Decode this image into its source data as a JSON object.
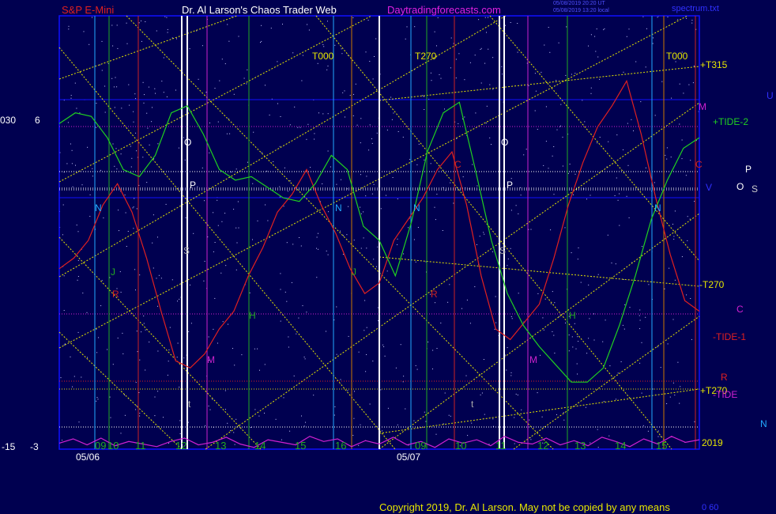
{
  "header": {
    "symbol": "S&P E-Mini",
    "author": "Dr. Al Larson's Chaos Trader Web",
    "site": "Daytradingforecasts.com",
    "stamp_ut": "05/08/2019 20:20 UT",
    "stamp_local": "05/08/2019 13:20 local",
    "file": "spectrum.txt"
  },
  "footer": {
    "copyright": "Copyright 2019, Dr. Al Larson. May not be copied by any means",
    "corner": "0  60"
  },
  "left_scale": {
    "top_a": "030",
    "top_b": "6",
    "bot_a": "-15",
    "bot_b": "-3"
  },
  "colors": {
    "background": "#000050",
    "frame": "#1010ff",
    "price": "#e02020",
    "tide2": "#20d020",
    "spectrum": "#d020d0",
    "yellow": "#e6e600",
    "white": "#ffffff"
  },
  "chart_data": {
    "type": "line",
    "title": "S&P E-Mini",
    "dates": [
      "05/06",
      "05/07"
    ],
    "hour_ticks": [
      {
        "day": "05/06",
        "labels": [
          "09",
          "10",
          "11",
          "12",
          "13",
          "14",
          "15",
          "16"
        ]
      },
      {
        "day": "05/07",
        "labels": [
          "09",
          "10",
          "11",
          "12",
          "13",
          "14",
          "15"
        ]
      }
    ],
    "right_labels": [
      {
        "text": "+T315",
        "color": "#e6e600"
      },
      {
        "text": "M",
        "color": "#d020d0"
      },
      {
        "text": "+TIDE-2",
        "color": "#20d020"
      },
      {
        "text": "V",
        "color": "#3030ff"
      },
      {
        "text": "-T270",
        "color": "#e6e600"
      },
      {
        "text": "-TIDE-1",
        "color": "#e02020"
      },
      {
        "text": "+T270",
        "color": "#e6e600"
      },
      {
        "text": "-TIDE",
        "color": "#d020d0"
      },
      {
        "text": "2019",
        "color": "#e6e600"
      },
      {
        "text": "U",
        "color": "#3030ff"
      },
      {
        "text": "P",
        "color": "#ffffff"
      },
      {
        "text": "O",
        "color": "#ffffff"
      },
      {
        "text": "S",
        "color": "#cccccc"
      },
      {
        "text": "C",
        "color": "#d020d0"
      },
      {
        "text": "R",
        "color": "#e02020"
      },
      {
        "text": "N",
        "color": "#22aaff"
      }
    ],
    "top_labels": [
      "T000",
      "T270",
      "T000"
    ],
    "series": [
      {
        "name": "Price",
        "color": "#e02020",
        "values": [
          0.42,
          0.45,
          0.5,
          0.6,
          0.66,
          0.58,
          0.45,
          0.3,
          0.16,
          0.14,
          0.18,
          0.25,
          0.3,
          0.4,
          0.48,
          0.58,
          0.63,
          0.7,
          0.6,
          0.52,
          0.42,
          0.35,
          0.38,
          0.5,
          0.56,
          0.62,
          0.7,
          0.75,
          0.6,
          0.4,
          0.25,
          0.22,
          0.27,
          0.32,
          0.45,
          0.6,
          0.72,
          0.82,
          0.88,
          0.95,
          0.8,
          0.62,
          0.46,
          0.33,
          0.3
        ]
      },
      {
        "name": "+TIDE-2",
        "color": "#20d020",
        "values": [
          0.83,
          0.86,
          0.85,
          0.79,
          0.7,
          0.68,
          0.74,
          0.86,
          0.88,
          0.8,
          0.7,
          0.67,
          0.68,
          0.65,
          0.62,
          0.61,
          0.66,
          0.74,
          0.7,
          0.54,
          0.5,
          0.4,
          0.55,
          0.75,
          0.86,
          0.89,
          0.7,
          0.5,
          0.35,
          0.26,
          0.2,
          0.15,
          0.1,
          0.1,
          0.14,
          0.26,
          0.4,
          0.56,
          0.67,
          0.76,
          0.79
        ]
      },
      {
        "name": "Spectrum",
        "color": "#d020d0",
        "values": [
          0.07,
          0.12,
          0.05,
          0.13,
          0.04,
          0.09,
          0.06,
          0.03,
          0.09,
          0.13,
          0.05,
          0.08,
          0.14,
          0.06,
          0.02,
          0.11,
          0.08,
          0.05,
          0.15,
          0.09,
          0.12,
          0.03,
          0.1,
          0.06,
          0.14,
          0.05,
          0.09,
          0.02,
          0.12,
          0.07,
          0.11,
          0.04,
          0.15,
          0.08,
          0.06,
          0.13,
          0.05,
          0.1,
          0.04,
          0.14,
          0.09,
          0.03,
          0.12,
          0.06,
          0.15,
          0.08,
          0.11
        ]
      }
    ]
  }
}
